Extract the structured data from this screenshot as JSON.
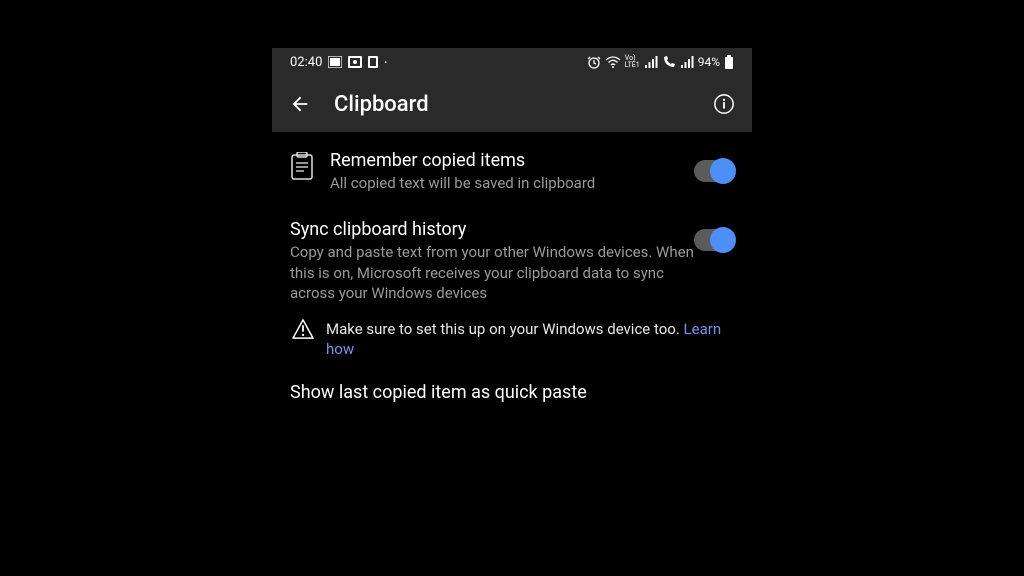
{
  "statusbar": {
    "time": "02:40",
    "battery": "94%"
  },
  "appbar": {
    "title": "Clipboard"
  },
  "settings": {
    "remember": {
      "title": "Remember copied items",
      "sub": "All copied text will be saved in clipboard",
      "on": true
    },
    "sync": {
      "title": "Sync clipboard history",
      "sub": "Copy and paste text from your other Windows devices. When this is on, Microsoft receives your clipboard data to sync across your Windows devices",
      "on": true,
      "warning": "Make sure to set this up on your Windows device too.",
      "learn": "Learn how"
    },
    "quickpaste": {
      "title": "Show last copied item as quick paste"
    }
  }
}
